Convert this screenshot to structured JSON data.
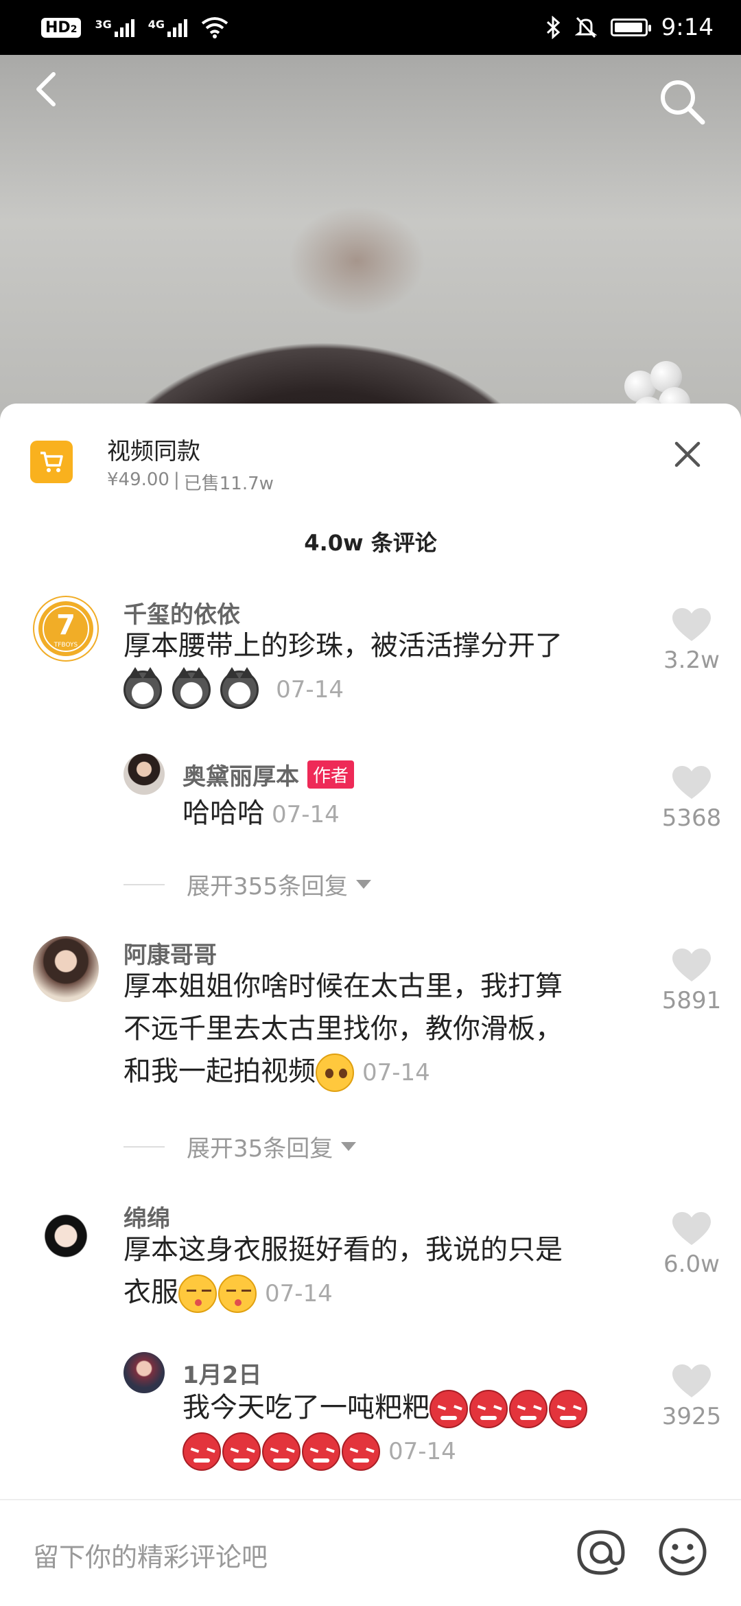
{
  "status_bar": {
    "hd": "HD",
    "hd_sub": "2",
    "sim1_label": "3G",
    "sim2_label": "4G",
    "time": "9:14",
    "battery_level": 0.95
  },
  "product": {
    "title": "视频同款",
    "price": "¥49.00",
    "separator": "|",
    "sold": "已售11.7w"
  },
  "comment_count": "4.0w 条评论",
  "comments": [
    {
      "username": "千玺的依依",
      "text": "厚本腰带上的珍珠，被活活撑分开了",
      "emojis": [
        "dog",
        "dog",
        "dog"
      ],
      "date": "07-14",
      "likes": "3.2w",
      "avatar_text": "7",
      "avatar_sub": "TFBOYS"
    },
    {
      "username": "奥黛丽厚本",
      "author_badge": "作者",
      "text": "哈哈哈",
      "date": "07-14",
      "likes": "5368"
    },
    {
      "expand": "展开355条回复"
    },
    {
      "username": "阿康哥哥",
      "text_line1": "厚本姐姐你啥时候在太古里，我打算",
      "text_line2": "不远千里去太古里找你，教你滑板，",
      "text_line3": "和我一起拍视频",
      "emoji": "beg",
      "date": "07-14",
      "likes": "5891"
    },
    {
      "expand": "展开35条回复"
    },
    {
      "username": "绵绵",
      "text_line1": "厚本这身衣服挺好看的，我说的只是",
      "text_line2": "衣服",
      "emojis": [
        "kiss",
        "kiss"
      ],
      "date": "07-14",
      "likes": "6.0w"
    },
    {
      "username": "1月2日",
      "text": "我今天吃了一吨粑粑",
      "emojis_line1": [
        "angry",
        "angry",
        "angry",
        "angry"
      ],
      "emojis_line2": [
        "angry",
        "angry",
        "angry",
        "angry",
        "angry"
      ],
      "date": "07-14",
      "likes": "3925"
    }
  ],
  "input": {
    "placeholder": "留下你的精彩评论吧"
  },
  "icons": {
    "back": "back-arrow-icon",
    "search": "search-icon",
    "cart": "shopping-cart-icon",
    "close": "close-icon",
    "heart": "heart-icon",
    "at": "at-mention-icon",
    "smile": "emoji-icon"
  },
  "colors": {
    "cart_bg": "#f9b11e",
    "author_badge": "#ee2a57",
    "heart": "#dddddd"
  }
}
